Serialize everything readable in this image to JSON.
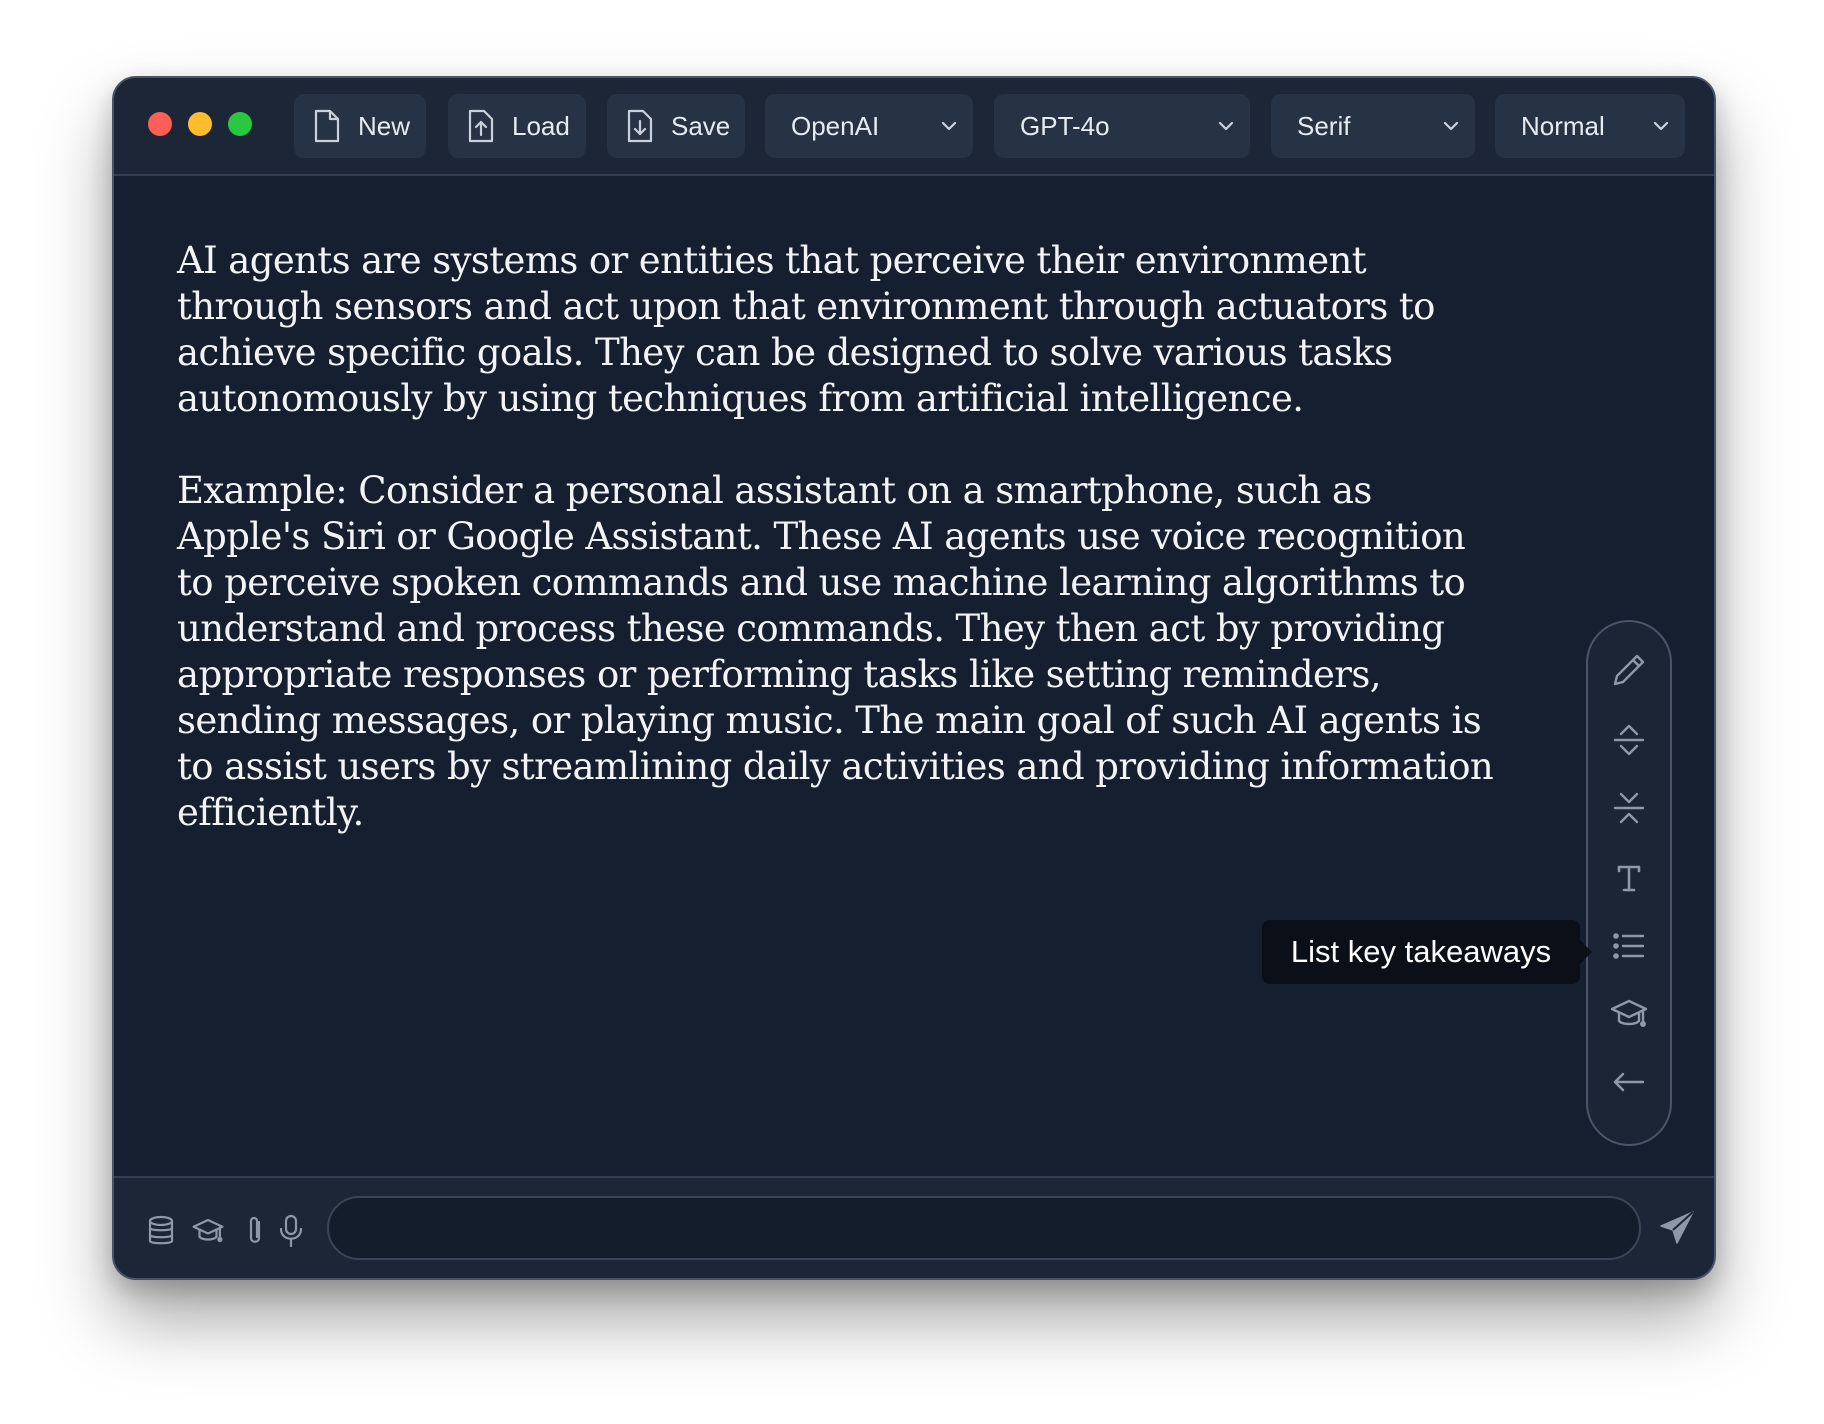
{
  "toolbar": {
    "new_label": "New",
    "load_label": "Load",
    "save_label": "Save",
    "provider": "OpenAI",
    "model": "GPT-4o",
    "font": "Serif",
    "size": "Normal"
  },
  "content": {
    "paragraphs": [
      "AI agents are systems or entities that perceive their environment through sensors and act upon that environment through actuators to achieve specific goals. They can be designed to solve various tasks autonomously by using techniques from artificial intelligence.",
      "Example: Consider a personal assistant on a smartphone, such as Apple's Siri or Google Assistant. These AI agents use voice recognition to perceive spoken commands and use machine learning algorithms to understand and process these commands. They then act by providing appropriate responses or performing tasks like setting reminders, sending messages, or playing music. The main goal of such AI agents is to assist users by streamlining daily activities and providing information efficiently."
    ]
  },
  "side_tools": {
    "icons": [
      "pencil-icon",
      "expand-icon",
      "collapse-icon",
      "text-icon",
      "list-icon",
      "graduation-cap-icon",
      "arrow-left-icon"
    ],
    "tooltip": "List key takeaways"
  },
  "bottom": {
    "icons": [
      "database-icon",
      "graduation-cap-icon",
      "paperclip-icon",
      "microphone-icon",
      "send-icon"
    ],
    "input_value": "",
    "input_placeholder": ""
  },
  "colors": {
    "window_bg": "#151f2f",
    "toolbar_bg": "#1c2636",
    "button_bg": "#273244",
    "text": "#f1f3f7",
    "icon": "#8e98a8",
    "traffic_red": "#ff5f57",
    "traffic_yellow": "#febc2e",
    "traffic_green": "#28c840"
  }
}
